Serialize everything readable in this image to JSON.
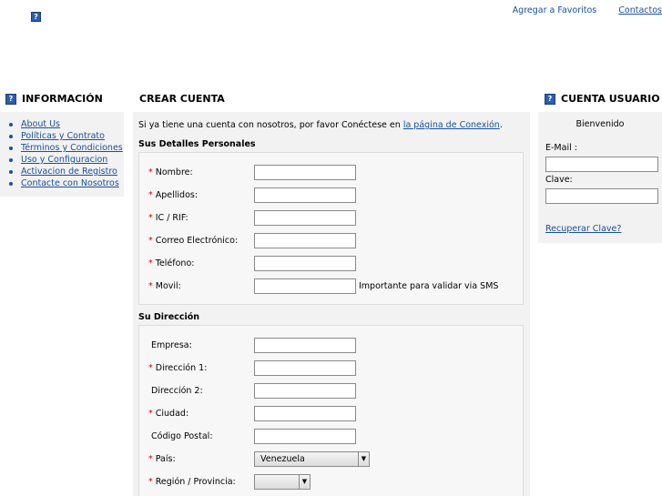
{
  "header": {
    "logo_icon": "help-icon",
    "links": [
      "Agregar a Favoritos",
      "Contactos"
    ]
  },
  "left": {
    "title": "INFORMACIÓN",
    "items": [
      "About Us",
      "Políticas y Contrato",
      "Términos y Condiciones",
      "Uso y Configuracion",
      "Activacion de Registro",
      "Contacte con Nosotros"
    ]
  },
  "center": {
    "title": "CREAR CUENTA",
    "intro_text": "Si ya tiene una cuenta con nosotros, por favor Conéctese en",
    "intro_link": "la página de Conexión",
    "intro_end": ".",
    "personal": {
      "title": "Sus Detalles Personales",
      "fields": [
        {
          "label": "Nombre:",
          "required": "*",
          "value": ""
        },
        {
          "label": "Apellidos:",
          "required": "*",
          "value": ""
        },
        {
          "label": "IC / RIF:",
          "required": "*",
          "value": ""
        },
        {
          "label": "Correo Electrónico:",
          "required": "*",
          "value": ""
        },
        {
          "label": "Teléfono:",
          "required": "*",
          "value": ""
        },
        {
          "label": "Movil:",
          "required": "*",
          "value": "",
          "note": "Importante para validar via SMS"
        }
      ]
    },
    "address": {
      "title": "Su Dirección",
      "fields": [
        {
          "label": "Empresa:",
          "required": "",
          "value": ""
        },
        {
          "label": "Dirección 1:",
          "required": "*",
          "value": ""
        },
        {
          "label": "Dirección 2:",
          "required": "",
          "value": ""
        },
        {
          "label": "Ciudad:",
          "required": "*",
          "value": ""
        },
        {
          "label": "Código Postal:",
          "required": "",
          "value": ""
        }
      ],
      "country_label": "País:",
      "country_required": "*",
      "country_value": "Venezuela",
      "region_label": "Región / Provincia:",
      "region_required": "*",
      "region_value": ""
    }
  },
  "right": {
    "title": "CUENTA USUARIO",
    "welcome": "Bienvenido",
    "email_label": "E-Mail :",
    "email_value": "",
    "password_label": "Clave:",
    "password_value": "",
    "recover_link": "Recuperar Clave?"
  },
  "colors": {
    "link": "#1a4fa0",
    "required": "#cc0000",
    "panel": "#f2f2f2",
    "icon": "#2a5eb0"
  }
}
